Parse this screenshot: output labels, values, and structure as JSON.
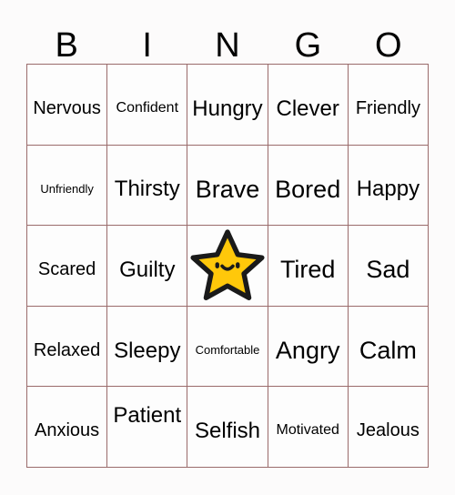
{
  "card": {
    "title": "BINGO",
    "header_letters": [
      "B",
      "I",
      "N",
      "G",
      "O"
    ],
    "colors": {
      "border": "#9a6b6b",
      "background": "#fcfbfb",
      "cell_background": "#fdfdfd",
      "text": "#000000",
      "star_fill": "#ffc80a",
      "star_outline": "#1a1a1a"
    },
    "grid": {
      "rows": 5,
      "columns": 5,
      "cells": [
        [
          {
            "label": "Nervous",
            "size": "md",
            "align": "lower"
          },
          {
            "label": "Confident",
            "size": "sm",
            "align": "lower"
          },
          {
            "label": "Hungry",
            "size": "lg",
            "align": "lower"
          },
          {
            "label": "Clever",
            "size": "lg",
            "align": "lower"
          },
          {
            "label": "Friendly",
            "size": "md",
            "align": "lower"
          }
        ],
        [
          {
            "label": "Unfriendly",
            "size": "xs",
            "align": "lower"
          },
          {
            "label": "Thirsty",
            "size": "lg",
            "align": "lower"
          },
          {
            "label": "Brave",
            "size": "xl",
            "align": "lower"
          },
          {
            "label": "Bored",
            "size": "xl",
            "align": "lower"
          },
          {
            "label": "Happy",
            "size": "lg",
            "align": "lower"
          }
        ],
        [
          {
            "label": "Scared",
            "size": "md",
            "align": "lower"
          },
          {
            "label": "Guilty",
            "size": "lg",
            "align": "lower"
          },
          {
            "label": "",
            "size": "md",
            "align": "lower",
            "free_space": true,
            "icon": "smiling-star-icon"
          },
          {
            "label": "Tired",
            "size": "xl",
            "align": "lower"
          },
          {
            "label": "Sad",
            "size": "xl",
            "align": "lower"
          }
        ],
        [
          {
            "label": "Relaxed",
            "size": "md",
            "align": "lower"
          },
          {
            "label": "Sleepy",
            "size": "lg",
            "align": "lower"
          },
          {
            "label": "Comfortable",
            "size": "xs",
            "align": "lower"
          },
          {
            "label": "Angry",
            "size": "xl",
            "align": "lower"
          },
          {
            "label": "Calm",
            "size": "xl",
            "align": "lower"
          }
        ],
        [
          {
            "label": "Anxious",
            "size": "md",
            "align": "lower"
          },
          {
            "label": "Patient",
            "size": "lg",
            "align": "upper"
          },
          {
            "label": "Selfish",
            "size": "lg",
            "align": "lower"
          },
          {
            "label": "Motivated",
            "size": "sm",
            "align": "lower"
          },
          {
            "label": "Jealous",
            "size": "md",
            "align": "lower"
          }
        ]
      ]
    }
  }
}
